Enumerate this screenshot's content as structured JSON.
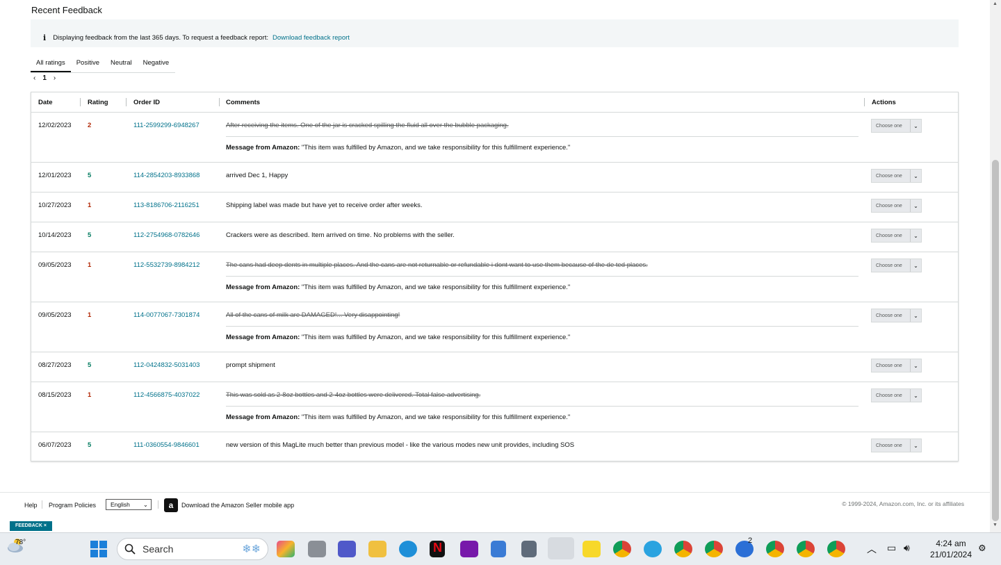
{
  "page": {
    "title": "Recent Feedback",
    "info_text": "Displaying feedback from the last 365 days. To request a feedback report:",
    "info_link": "Download feedback report",
    "tabs": [
      "All ratings",
      "Positive",
      "Neutral",
      "Negative"
    ],
    "pager": {
      "prev": "‹",
      "page": "1",
      "next": "›"
    }
  },
  "table": {
    "headers": {
      "date": "Date",
      "rating": "Rating",
      "order": "Order ID",
      "comments": "Comments",
      "actions": "Actions"
    },
    "select_label": "Choose one",
    "message_label": "Message from Amazon:",
    "message_text": "\"This item was fulfilled by Amazon, and we take responsibility for this fulfillment experience.\"",
    "rows": [
      {
        "date": "12/02/2023",
        "rating": "2",
        "order": "111-2599299-6948267",
        "comment": "After receiving the items. One of the jar is cracked spilling the fluid all over the bubble packaging.",
        "struck": true
      },
      {
        "date": "12/01/2023",
        "rating": "5",
        "order": "114-2854203-8933868",
        "comment": "arrived Dec 1, Happy",
        "struck": false
      },
      {
        "date": "10/27/2023",
        "rating": "1",
        "order": "113-8186706-2116251",
        "comment": "Shipping label was made but have yet to receive order after weeks.",
        "struck": false
      },
      {
        "date": "10/14/2023",
        "rating": "5",
        "order": "112-2754968-0782646",
        "comment": "Crackers were as described. Item arrived on time. No problems with the seller.",
        "struck": false
      },
      {
        "date": "09/05/2023",
        "rating": "1",
        "order": "112-5532739-8984212",
        "comment": "The cans had deep dents in multiple places. And the cans are not returnable or refundable i dont want to use them because of the de ted places.",
        "struck": true
      },
      {
        "date": "09/05/2023",
        "rating": "1",
        "order": "114-0077067-7301874",
        "comment": "All of the cans of milk are DAMAGED!... Very disappointing!",
        "struck": true
      },
      {
        "date": "08/27/2023",
        "rating": "5",
        "order": "112-0424832-5031403",
        "comment": "prompt shipment",
        "struck": false
      },
      {
        "date": "08/15/2023",
        "rating": "1",
        "order": "112-4566875-4037022",
        "comment": "This was sold as 2-8oz bottles and 2-4oz bottles were delivered. Total false advertising.",
        "struck": true
      },
      {
        "date": "06/07/2023",
        "rating": "5",
        "order": "111-0360554-9846601",
        "comment": "new version of this MagLite much better than previous model - like the various modes new unit provides, including SOS",
        "struck": false
      }
    ]
  },
  "footer": {
    "help": "Help",
    "policies": "Program Policies",
    "language": "English",
    "app_text": "Download the Amazon Seller mobile app",
    "copyright": "© 1999-2024, Amazon.com, Inc. or its affiliates",
    "feedback_button": "FEEDBACK ×"
  },
  "taskbar": {
    "weather": "78°",
    "search_placeholder": "Search",
    "time": "4:24 am",
    "date": "21/01/2024",
    "badge": "2"
  },
  "colors": {
    "link": "#00718a",
    "good": "#067d62",
    "bad": "#b12704"
  }
}
